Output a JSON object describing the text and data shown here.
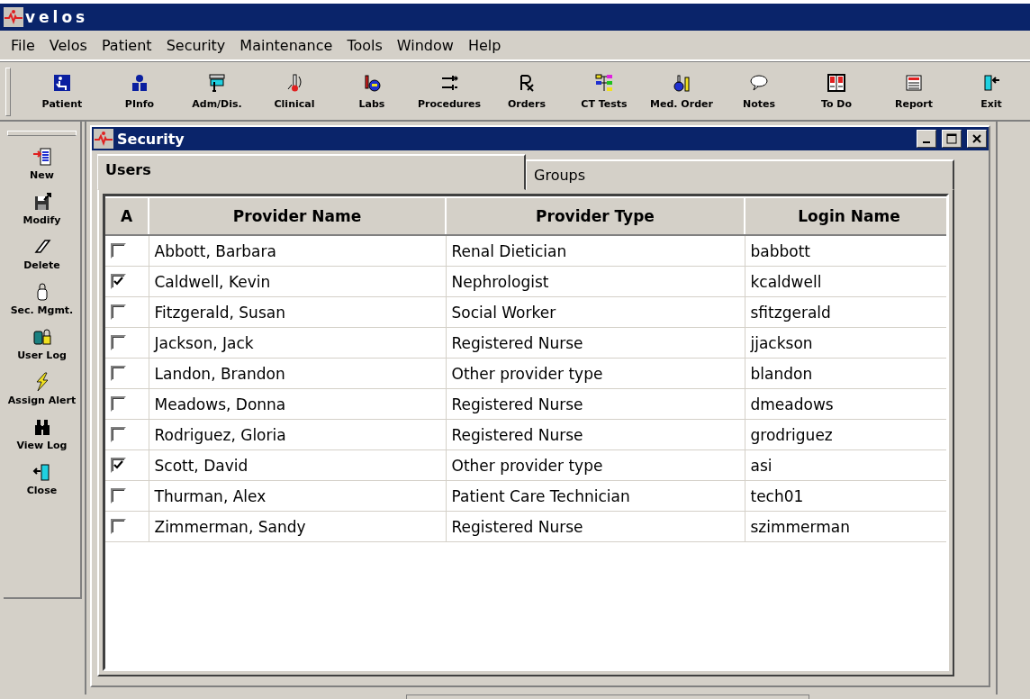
{
  "window": {
    "title": "velos"
  },
  "menu": [
    "File",
    "Velos",
    "Patient",
    "Security",
    "Maintenance",
    "Tools",
    "Window",
    "Help"
  ],
  "toolbar": [
    "Patient",
    "PInfo",
    "Adm/Dis.",
    "Clinical",
    "Labs",
    "Procedures",
    "Orders",
    "CT Tests",
    "Med. Order",
    "Notes",
    "To Do",
    "Report",
    "Exit"
  ],
  "sidebar": [
    "New",
    "Modify",
    "Delete",
    "Sec. Mgmt.",
    "User Log",
    "Assign Alert",
    "View Log",
    "Close"
  ],
  "child_window": {
    "title": "Security",
    "tabs": [
      {
        "label": "Users",
        "selected": true
      },
      {
        "label": "Groups",
        "selected": false
      }
    ],
    "table": {
      "columns": [
        "A",
        "Provider Name",
        "Provider Type",
        "Login Name"
      ],
      "rows": [
        {
          "checked": false,
          "name": "Abbott, Barbara",
          "type": "Renal Dietician",
          "login": "babbott"
        },
        {
          "checked": true,
          "name": "Caldwell, Kevin",
          "type": "Nephrologist",
          "login": "kcaldwell"
        },
        {
          "checked": false,
          "name": "Fitzgerald, Susan",
          "type": "Social Worker",
          "login": "sfitzgerald"
        },
        {
          "checked": false,
          "name": "Jackson, Jack",
          "type": "Registered Nurse",
          "login": "jjackson"
        },
        {
          "checked": false,
          "name": "Landon, Brandon",
          "type": "Other provider type",
          "login": "blandon"
        },
        {
          "checked": false,
          "name": "Meadows, Donna",
          "type": "Registered Nurse",
          "login": "dmeadows"
        },
        {
          "checked": false,
          "name": "Rodriguez, Gloria",
          "type": "Registered Nurse",
          "login": "grodriguez"
        },
        {
          "checked": true,
          "name": "Scott, David",
          "type": "Other provider type",
          "login": "asi"
        },
        {
          "checked": false,
          "name": "Thurman, Alex",
          "type": "Patient Care Technician",
          "login": "tech01"
        },
        {
          "checked": false,
          "name": "Zimmerman, Sandy",
          "type": "Registered Nurse",
          "login": "szimmerman"
        }
      ]
    }
  }
}
